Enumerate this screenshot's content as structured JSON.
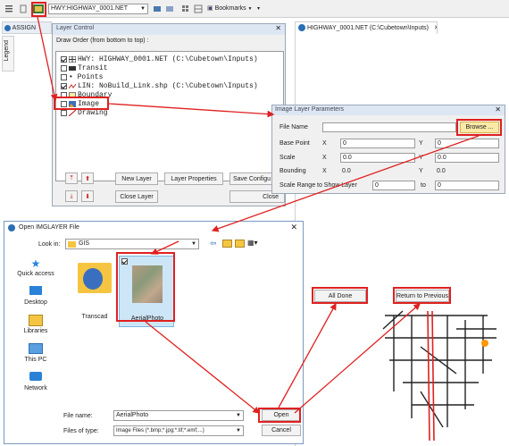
{
  "toolbar": {
    "layer_select_value": "HWY:HIGHWAY_0001.NET",
    "bookmarks_label": "Bookmarks"
  },
  "tabs": {
    "assign_tab": "ASSIGN",
    "highway_tab": "HIGHWAY_0001.NET (C:\\Cubetown\\Inputs)",
    "legend_tab": "Legend"
  },
  "layer_control": {
    "title": "Layer Control",
    "subtitle": "Draw Order (from bottom to top) :",
    "layers": [
      {
        "label": "HWY: HIGHWAY_0001.NET (C:\\Cubetown\\Inputs)",
        "checked": true
      },
      {
        "label": "Transit",
        "checked": false
      },
      {
        "label": "• Points",
        "checked": false
      },
      {
        "label": "LIN: NoBuild_Link.shp (C:\\Cubetown\\Inputs)",
        "checked": true
      },
      {
        "label": "Boundary",
        "checked": false
      },
      {
        "label": "Image",
        "checked": false
      },
      {
        "label": "Drawing",
        "checked": false
      }
    ],
    "new_layer": "New Layer",
    "layer_properties": "Layer Properties",
    "save_config": "Save Configu",
    "close_layer": "Close Layer",
    "close": "Close"
  },
  "image_params": {
    "title": "Image Layer Parameters",
    "file_name_label": "File Name",
    "browse": "Browse ...",
    "base_point_label": "Base Point",
    "scale_label": "Scale",
    "bounding_label": "Bounding",
    "x": "X",
    "y": "Y",
    "base_x": "0",
    "base_y": "0",
    "scale_x": "0.0",
    "scale_y": "0.0",
    "bound_x": "0.0",
    "bound_y": "0.0",
    "scale_range_label": "Scale Range to Show Layer",
    "range_from": "0",
    "to_label": "to",
    "range_to": "0",
    "all_done": "All Done",
    "return_previous": "Return to Previous"
  },
  "open_dialog": {
    "title": "Open IMGLAYER File",
    "look_in_label": "Look in:",
    "look_in_value": "GIS",
    "sidebar": [
      "Quick access",
      "Desktop",
      "Libraries",
      "This PC",
      "Network"
    ],
    "files": [
      "Transcad",
      "AerialPhoto"
    ],
    "file_name_label": "File name:",
    "file_name_value": "AerialPhoto",
    "files_of_type_label": "Files of type:",
    "files_of_type_value": "Image Files (*.bmp;*.jpg;*.tif;*.emf;...)",
    "open": "Open",
    "cancel": "Cancel"
  },
  "colors": {
    "annotation_red": "#e02020",
    "title_bar": "#dde7f3",
    "folder": "#f5c542"
  }
}
